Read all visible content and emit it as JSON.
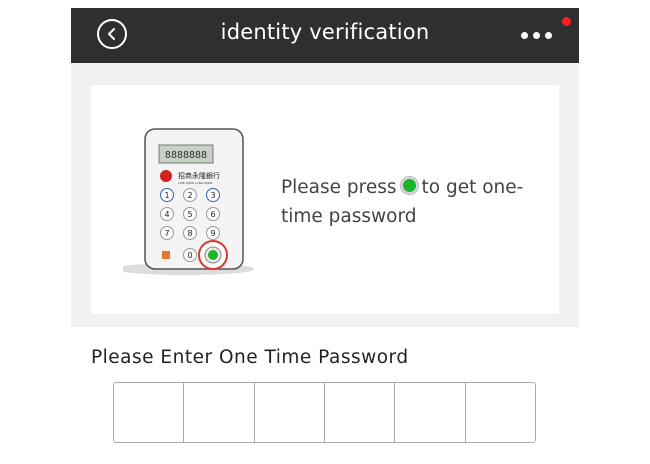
{
  "header": {
    "title": "identity verification",
    "back_icon": "chevron-left-icon",
    "more_icon": "more-horizontal-icon",
    "notification_color": "#ff1f1f"
  },
  "token_device": {
    "display": "8888888",
    "bank_name_cn": "招商永隆銀行",
    "bank_name_en": "CMB WING LUNG BANK",
    "keys": [
      "1",
      "2",
      "3",
      "4",
      "5",
      "6",
      "7",
      "8",
      "9",
      "0"
    ]
  },
  "instruction": {
    "before": "Please press",
    "after": "to get one-time password",
    "button_color": "#1db32c",
    "highlight_color": "#e0392b"
  },
  "otp": {
    "label": "Please Enter One Time Password",
    "cells": [
      "",
      "",
      "",
      "",
      "",
      ""
    ]
  }
}
